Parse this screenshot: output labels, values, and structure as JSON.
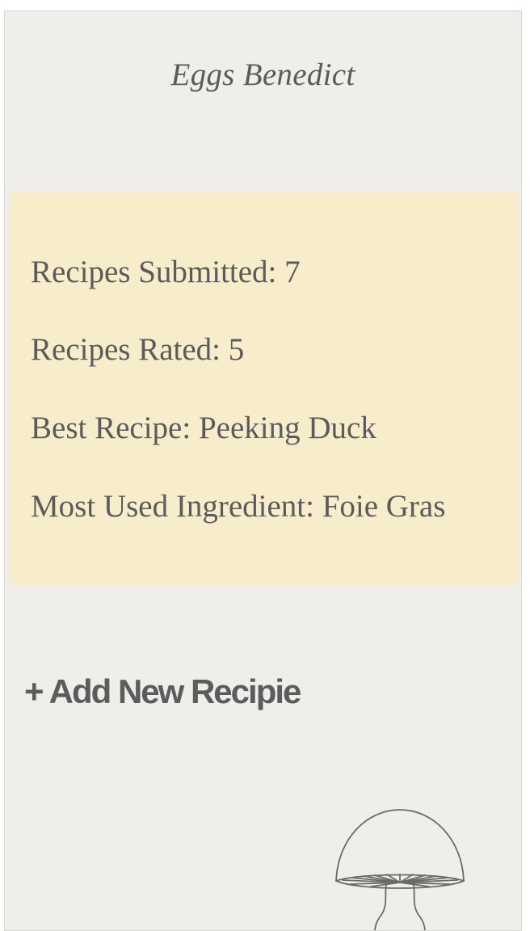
{
  "header": {
    "title": "Eggs Benedict"
  },
  "stats": {
    "recipes_submitted": "Recipes Submitted: 7",
    "recipes_rated": "Recipes Rated: 5",
    "best_recipe": "Best Recipe: Peeking Duck",
    "most_used_ingredient": "Most Used Ingredient: Foie Gras"
  },
  "actions": {
    "add_new_recipe_label": "+ Add New Recipie"
  },
  "decor": {
    "logo_icon": "mushroom-icon"
  },
  "colors": {
    "panel_background": "#efeeea",
    "stats_background": "#f7edcb",
    "text": "#5b5b5b"
  }
}
